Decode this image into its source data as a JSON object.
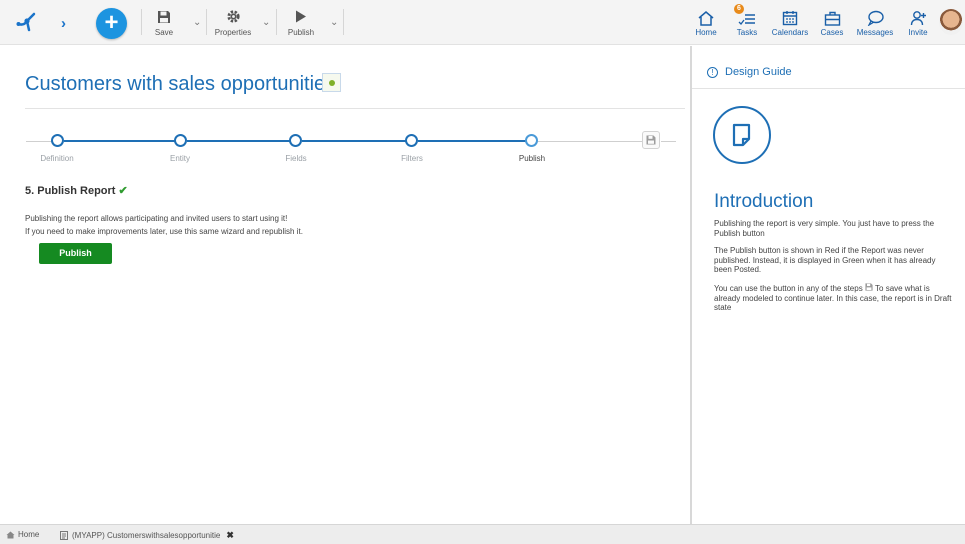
{
  "toolbar": {
    "save_label": "Save",
    "properties_label": "Properties",
    "publish_label": "Publish",
    "add_icon": "plus-icon"
  },
  "nav": [
    {
      "label": "Home",
      "icon": "home-icon"
    },
    {
      "label": "Tasks",
      "icon": "tasks-icon",
      "badge": "6"
    },
    {
      "label": "Calendars",
      "icon": "calendar-icon"
    },
    {
      "label": "Cases",
      "icon": "briefcase-icon"
    },
    {
      "label": "Messages",
      "icon": "chat-icon"
    },
    {
      "label": "Invite",
      "icon": "invite-icon"
    }
  ],
  "page": {
    "title": "Customers with sales opportunities",
    "status_color": "#7fb028"
  },
  "wizard": {
    "steps": [
      {
        "label": "Definition",
        "done": true
      },
      {
        "label": "Entity",
        "done": true
      },
      {
        "label": "Fields",
        "done": true
      },
      {
        "label": "Filters",
        "done": true
      },
      {
        "label": "Publish",
        "active": true
      }
    ]
  },
  "report": {
    "heading": "5. Publish Report",
    "line1": "Publishing the report allows participating and invited users to start using it!",
    "line2": "If you need to make improvements later, use this same wizard and republish it.",
    "publish_button": "Publish"
  },
  "guide": {
    "header": "Design Guide",
    "title": "Introduction",
    "p1": "Publishing the report is very simple. You just have to press the Publish button",
    "p2": "The Publish button is shown in Red if the Report was never published. Instead, it is displayed in Green when it has already been Posted.",
    "p3a": "You can use the button in any of the steps",
    "p3b": "To save what is already modeled to continue later. In this case, the report is in Draft state"
  },
  "tabs": {
    "home": "Home",
    "active": "(MYAPP) Customerswithsalesopportunitie"
  },
  "colors": {
    "accent": "#1e6fb5",
    "publish_green": "#158a21",
    "add_blue": "#1d94e0"
  }
}
